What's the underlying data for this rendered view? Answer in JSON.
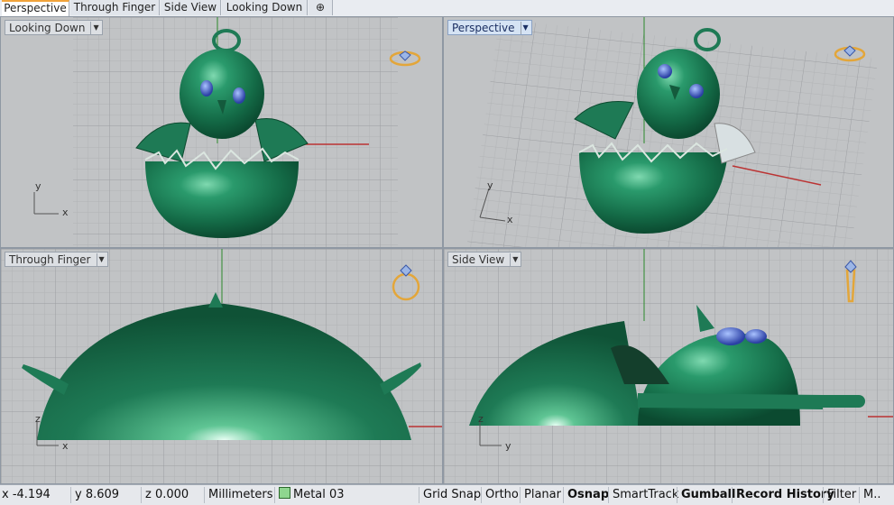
{
  "tabs": [
    {
      "label": "Perspective",
      "active": true
    },
    {
      "label": "Through Finger",
      "active": false
    },
    {
      "label": "Side View",
      "active": false
    },
    {
      "label": "Looking Down",
      "active": false
    }
  ],
  "add_tab_label": "⊕",
  "viewports": {
    "top_left": {
      "label": "Looking Down",
      "axis_v": "y",
      "axis_h": "x"
    },
    "top_right": {
      "label": "Perspective",
      "axis_v": "y",
      "axis_h": "x"
    },
    "bottom_left": {
      "label": "Through Finger",
      "axis_v": "z",
      "axis_h": "x"
    },
    "bottom_right": {
      "label": "Side View",
      "axis_v": "z",
      "axis_h": "y"
    }
  },
  "dropdown_arrow": "▼",
  "status": {
    "x": "x -4.194",
    "y": "y 8.609",
    "z": "z 0.000",
    "units": "Millimeters",
    "layer": "Metal 03",
    "grid_snap": "Grid Snap",
    "ortho": "Ortho",
    "planar": "Planar",
    "osnap": "Osnap",
    "smarttrack": "SmartTrack",
    "gumball": "Gumball",
    "record_history": "Record History",
    "filter": "Filter",
    "more": "M.."
  },
  "colors": {
    "model": "#1e7a55",
    "grid_bg": "#c1c3c5",
    "accent_tab": "#f1a33a",
    "layer_swatch": "#8fd68f"
  },
  "icons": [
    "ring-gem-icon",
    "ring-front-icon",
    "ring-side-icon"
  ]
}
